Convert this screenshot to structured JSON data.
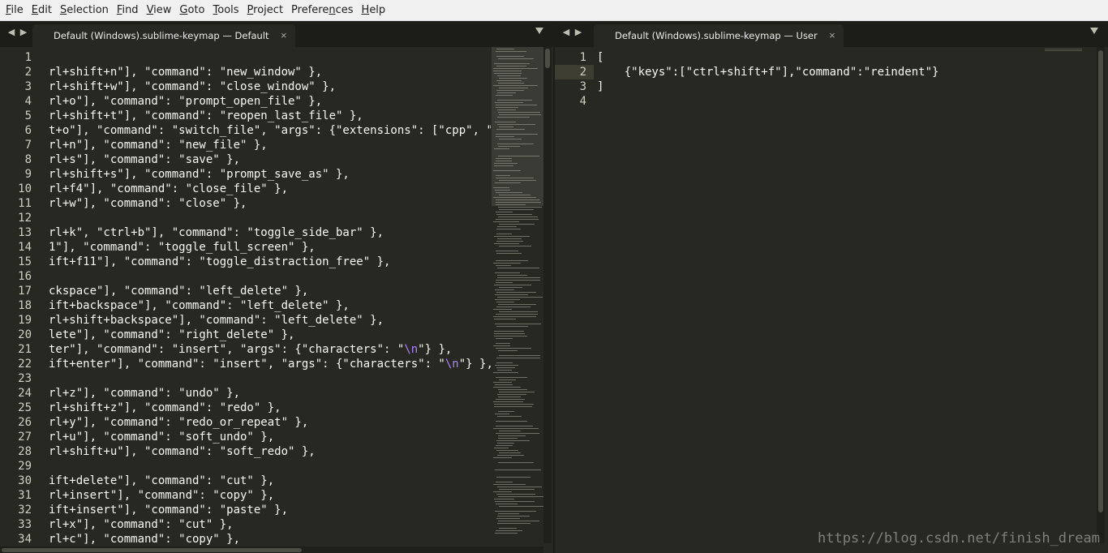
{
  "colors": {
    "editor_bg": "#272822",
    "text": "#f8f8f2",
    "line_number": "#cfcfc2",
    "escape": "#ae81ff",
    "menubar_bg": "#f0f0f0"
  },
  "menu": [
    {
      "label": "File",
      "mnemonic": "F",
      "rest": "ile"
    },
    {
      "label": "Edit",
      "mnemonic": "E",
      "rest": "dit"
    },
    {
      "label": "Selection",
      "mnemonic": "S",
      "rest": "election"
    },
    {
      "label": "Find",
      "mnemonic": "F",
      "rest": "ind",
      "mn_index": 1
    },
    {
      "label": "View",
      "mnemonic": "V",
      "rest": "iew"
    },
    {
      "label": "Goto",
      "mnemonic": "G",
      "rest": "oto"
    },
    {
      "label": "Tools",
      "mnemonic": "T",
      "rest": "ools"
    },
    {
      "label": "Project",
      "mnemonic": "P",
      "rest": "roject"
    },
    {
      "label": "Preferences",
      "mnemonic": "n",
      "rest": ""
    },
    {
      "label": "Help",
      "mnemonic": "H",
      "rest": "elp"
    }
  ],
  "left_pane": {
    "tab_title": "Default (Windows).sublime-keymap — Default",
    "close_glyph": "×",
    "lines": [
      {
        "n": "1",
        "text": ""
      },
      {
        "n": "2",
        "text": "rl+shift+n\"], \"command\": \"new_window\" },"
      },
      {
        "n": "3",
        "text": "rl+shift+w\"], \"command\": \"close_window\" },"
      },
      {
        "n": "4",
        "text": "rl+o\"], \"command\": \"prompt_open_file\" },"
      },
      {
        "n": "5",
        "text": "rl+shift+t\"], \"command\": \"reopen_last_file\" },"
      },
      {
        "n": "6",
        "text": "t+o\"], \"command\": \"switch_file\", \"args\": {\"extensions\": [\"cpp\", \"c"
      },
      {
        "n": "7",
        "text": "rl+n\"], \"command\": \"new_file\" },"
      },
      {
        "n": "8",
        "text": "rl+s\"], \"command\": \"save\" },"
      },
      {
        "n": "9",
        "text": "rl+shift+s\"], \"command\": \"prompt_save_as\" },"
      },
      {
        "n": "10",
        "text": "rl+f4\"], \"command\": \"close_file\" },"
      },
      {
        "n": "11",
        "text": "rl+w\"], \"command\": \"close\" },"
      },
      {
        "n": "12",
        "text": ""
      },
      {
        "n": "13",
        "text": "rl+k\", \"ctrl+b\"], \"command\": \"toggle_side_bar\" },"
      },
      {
        "n": "14",
        "text": "1\"], \"command\": \"toggle_full_screen\" },"
      },
      {
        "n": "15",
        "text": "ift+f11\"], \"command\": \"toggle_distraction_free\" },"
      },
      {
        "n": "16",
        "text": ""
      },
      {
        "n": "17",
        "text": "ckspace\"], \"command\": \"left_delete\" },"
      },
      {
        "n": "18",
        "text": "ift+backspace\"], \"command\": \"left_delete\" },"
      },
      {
        "n": "19",
        "text": "rl+shift+backspace\"], \"command\": \"left_delete\" },"
      },
      {
        "n": "20",
        "text": "lete\"], \"command\": \"right_delete\" },"
      },
      {
        "n": "21",
        "pre": "ter\"], \"command\": \"insert\", \"args\": {\"characters\": \"",
        "esc": "\\n",
        "post": "\"} },"
      },
      {
        "n": "22",
        "pre": "ift+enter\"], \"command\": \"insert\", \"args\": {\"characters\": \"",
        "esc": "\\n",
        "post": "\"} },"
      },
      {
        "n": "23",
        "text": ""
      },
      {
        "n": "24",
        "text": "rl+z\"], \"command\": \"undo\" },"
      },
      {
        "n": "25",
        "text": "rl+shift+z\"], \"command\": \"redo\" },"
      },
      {
        "n": "26",
        "text": "rl+y\"], \"command\": \"redo_or_repeat\" },"
      },
      {
        "n": "27",
        "text": "rl+u\"], \"command\": \"soft_undo\" },"
      },
      {
        "n": "28",
        "text": "rl+shift+u\"], \"command\": \"soft_redo\" },"
      },
      {
        "n": "29",
        "text": ""
      },
      {
        "n": "30",
        "text": "ift+delete\"], \"command\": \"cut\" },"
      },
      {
        "n": "31",
        "text": "rl+insert\"], \"command\": \"copy\" },"
      },
      {
        "n": "32",
        "text": "ift+insert\"], \"command\": \"paste\" },"
      },
      {
        "n": "33",
        "text": "rl+x\"], \"command\": \"cut\" },"
      },
      {
        "n": "34",
        "text": "rl+c\"], \"command\": \"copy\" },"
      }
    ]
  },
  "right_pane": {
    "tab_title": "Default (Windows).sublime-keymap — User",
    "close_glyph": "×",
    "current_line": 2,
    "lines": [
      {
        "n": "1",
        "text": "["
      },
      {
        "n": "2",
        "text": "    {\"keys\":[\"ctrl+shift+f\"],\"command\":\"reindent\"}"
      },
      {
        "n": "3",
        "text": "]"
      },
      {
        "n": "4",
        "text": ""
      }
    ]
  },
  "icons": {
    "nav_back": "◀",
    "nav_forward": "▶",
    "tab_list": "chevron-down-icon"
  },
  "watermark": "https://blog.csdn.net/finish_dream"
}
